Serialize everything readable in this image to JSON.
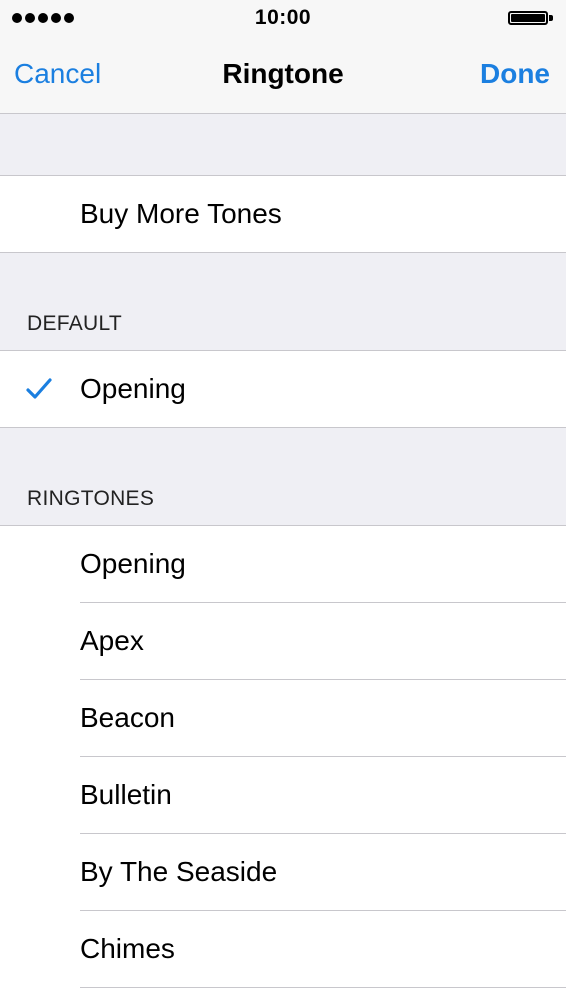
{
  "status_bar": {
    "time": "10:00"
  },
  "nav": {
    "cancel_label": "Cancel",
    "title": "Ringtone",
    "done_label": "Done"
  },
  "store": {
    "label": "Buy More Tones"
  },
  "default_section": {
    "header": "DEFAULT",
    "selected": "Opening"
  },
  "ringtones_section": {
    "header": "RINGTONES",
    "items": [
      "Opening",
      "Apex",
      "Beacon",
      "Bulletin",
      "By The Seaside",
      "Chimes"
    ]
  },
  "colors": {
    "accent": "#1b7fe0",
    "background": "#efeff4",
    "separator": "#c8c7cc"
  },
  "icons": {
    "selection": "checkmark-icon",
    "signal": "signal-dots-icon",
    "battery": "battery-icon"
  }
}
